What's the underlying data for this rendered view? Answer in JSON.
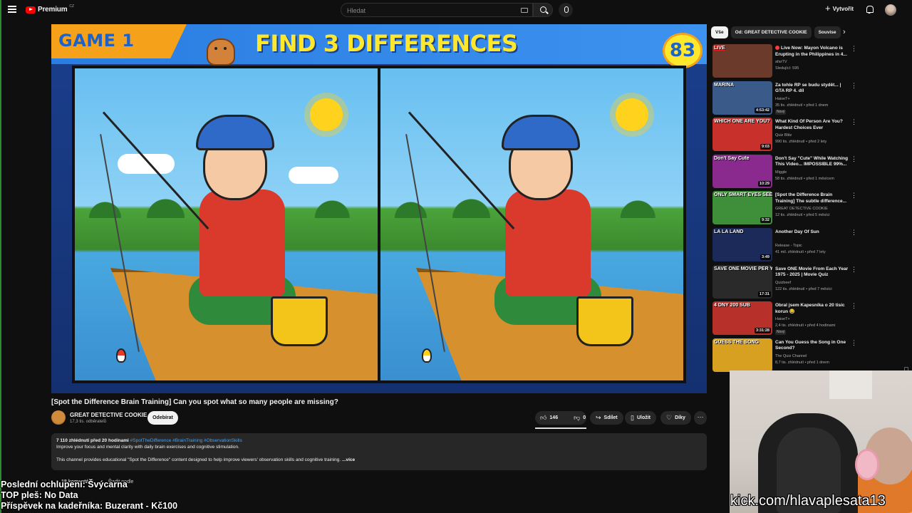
{
  "header": {
    "logo_text": "Premium",
    "logo_region": "CZ",
    "search_placeholder": "Hledat",
    "create_label": "Vytvořit",
    "icons": [
      "menu-icon",
      "youtube-logo-icon",
      "keyboard-icon",
      "search-icon",
      "mic-icon",
      "plus-icon",
      "bell-icon",
      "avatar"
    ]
  },
  "player": {
    "game_tag": "GAME 1",
    "banner_title": "FIND 3 DIFFERENCES",
    "counter": "83"
  },
  "video": {
    "title": "[Spot the Difference Brain Training] Can you spot what so many people are missing?",
    "channel_name": "GREAT DETECTIVE COOKIE",
    "channel_subs": "17,3 tis. odběratelů",
    "subscribe_label": "Odebírat",
    "likes": "146",
    "dislikes": "0",
    "share_label": "Sdílet",
    "save_label": "Uložit",
    "thanks_label": "Díky",
    "more_symbol": "⋯"
  },
  "description": {
    "meta": "7 110 zhlédnutí  před 20 hodinami",
    "tags": "#SpotTheDifference #BrainTraining #ObservationSkills",
    "line1": "Improve your focus and mental clarity with daily brain exercises and cognitive stimulation.",
    "line2": "This channel provides educational \"Spot the Difference\" content designed to help improve viewers' observation skills and cognitive training.",
    "more_label": "...více"
  },
  "comments": {
    "count_label": "18 komentářů",
    "sort_label": "Řadit podle"
  },
  "overlay_lines": [
    "Poslední ochlupení: Švýcarna",
    "TOP pleš: No Data",
    "Příspěvek na kadeřníka: Buzerant - Kč100"
  ],
  "webcam_caption": "kick.com/hlavaplesata13",
  "chips": [
    {
      "label": "Vše",
      "active": true
    },
    {
      "label": "Od: GREAT DETECTIVE COOKIE",
      "active": false
    },
    {
      "label": "Souvise",
      "active": false
    }
  ],
  "recommendations": [
    {
      "title": "Live Now: Mayon Volcano is Erupting in the Philippines in 4...",
      "channel": "afarTV",
      "meta": "Sledující: 595",
      "badge": "",
      "duration": "",
      "caption": "LIVE",
      "live": true,
      "thumb_color": "#6b3a2a"
    },
    {
      "title": "Za tohle RP se budu stydět... | GTA RP 4. díl",
      "channel": "HaiseT+",
      "meta": "35 tis. zhlédnutí • před 1 dnem",
      "badge": "Nový",
      "duration": "4:53:42",
      "caption": "MARINA",
      "live": false,
      "thumb_color": "#3a5a8a"
    },
    {
      "title": "What Kind Of Person Are You? Hardest Choices Ever",
      "channel": "Quiz Blitz",
      "meta": "990 tis. zhlédnutí • před 2 lety",
      "badge": "",
      "duration": "9:03",
      "caption": "WHICH ONE ARE YOU?",
      "live": false,
      "thumb_color": "#c8302c"
    },
    {
      "title": "Don't Say \"Cute\" While Watching This Video... IMPOSSIBLE 99%...",
      "channel": "Miggle",
      "meta": "58 tis. zhlédnutí • před 1 měsícem",
      "badge": "",
      "duration": "10:29",
      "caption": "Don't Say Cute",
      "live": false,
      "thumb_color": "#8a2a8e"
    },
    {
      "title": "[Spot the Difference Brain Training] The subtle difference...",
      "channel": "GREAT DETECTIVE COOKIE",
      "meta": "12 tis. zhlédnutí • před 5 měsíci",
      "badge": "",
      "duration": "9:32",
      "caption": "ONLY SMART EYES SEE",
      "live": false,
      "thumb_color": "#3f8f3a"
    },
    {
      "title": "Another Day Of Sun",
      "channel": "Release - Topic",
      "meta": "41 mil. zhlédnutí • před 7 lety",
      "badge": "",
      "duration": "3:49",
      "caption": "LA LA LAND",
      "live": false,
      "thumb_color": "#1c2a5a"
    },
    {
      "title": "Save ONE Movie From Each Year 1975 - 2025 | Movie Quiz",
      "channel": "Quizbeef",
      "meta": "122 tis. zhlédnutí • před 7 měsíci",
      "badge": "",
      "duration": "17:31",
      "caption": "SAVE ONE MOVIE PER YEAR",
      "live": false,
      "thumb_color": "#2a2a2a"
    },
    {
      "title": "Obral jsem Kapesníka o 20 tisíc korun 😂",
      "channel": "HaiseT+",
      "meta": "2,4 tis. zhlédnutí • před 4 hodinami",
      "badge": "Nový",
      "duration": "3:31:28",
      "caption": "4 DNY 200 SUB",
      "live": false,
      "thumb_color": "#b8302a"
    },
    {
      "title": "Can You Guess the Song in One Second?",
      "channel": "The Quiz Channel",
      "meta": "8,7 tis. zhlédnutí • před 1 dnem",
      "badge": "",
      "duration": "",
      "caption": "GUESS THE SONG",
      "live": false,
      "thumb_color": "#d8a020"
    }
  ]
}
